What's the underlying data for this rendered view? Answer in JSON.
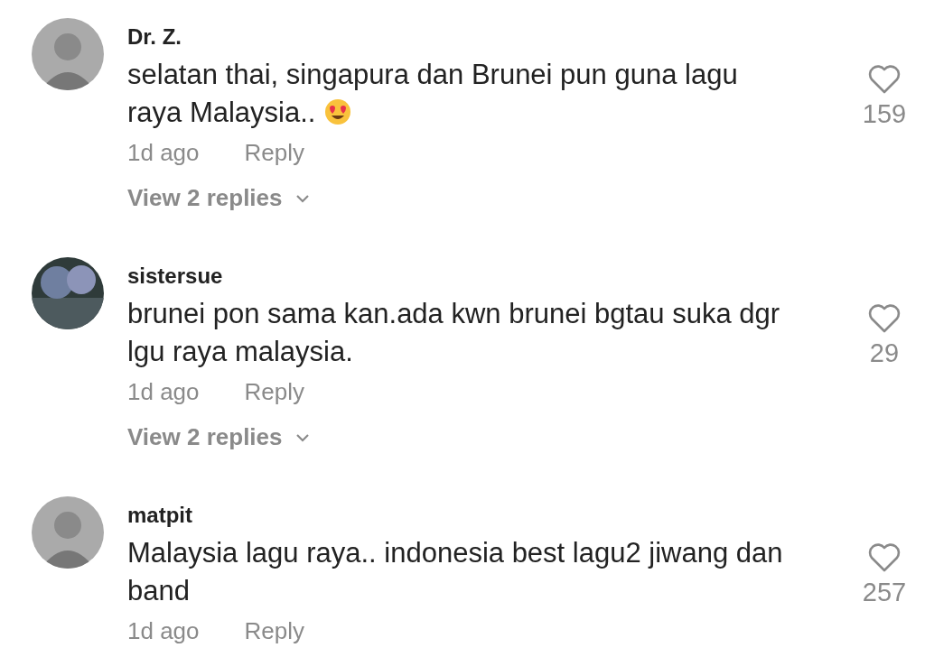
{
  "comments": [
    {
      "avatar": {
        "kind": "person"
      },
      "username": "Dr. Z.",
      "text": "selatan thai, singapura dan Brunei pun guna lagu raya Malaysia..",
      "emoji": {
        "kind": "heart_eyes"
      },
      "likes": "159",
      "time": "1d ago",
      "reply": "Reply",
      "view_replies": "View 2 replies"
    },
    {
      "avatar": {
        "kind": "landscape"
      },
      "username": "sistersue",
      "text": "brunei pon sama kan.ada kwn brunei bgtau suka dgr lgu raya malaysia.",
      "likes": "29",
      "time": "1d ago",
      "reply": "Reply",
      "view_replies": "View 2 replies"
    },
    {
      "avatar": {
        "kind": "person"
      },
      "username": "matpit",
      "text": "Malaysia lagu raya.. indonesia best lagu2 jiwang dan band",
      "likes": "257",
      "time": "1d ago",
      "reply": "Reply"
    }
  ]
}
